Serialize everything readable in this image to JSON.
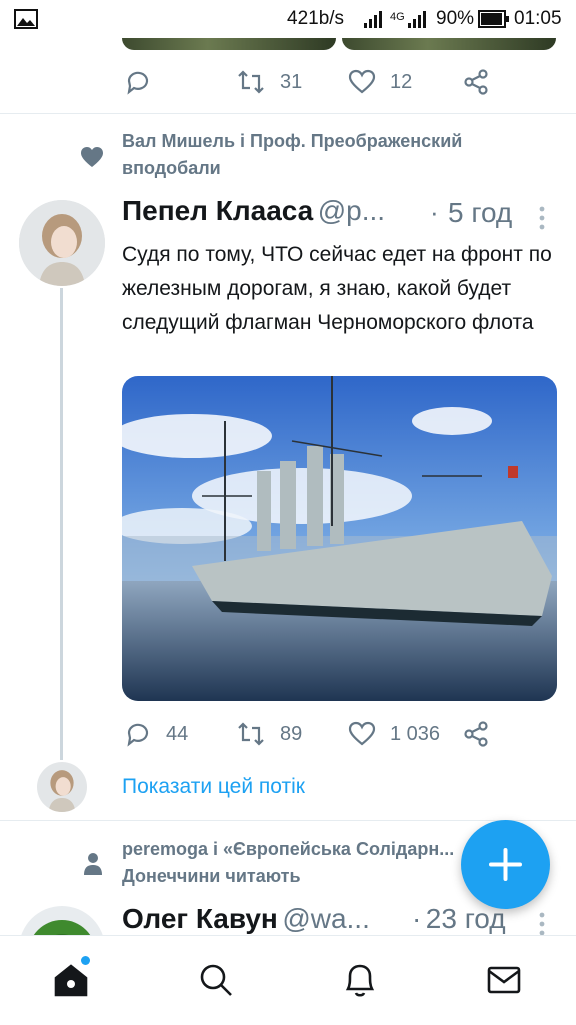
{
  "status_bar": {
    "speed": "421b/s",
    "network": "4G",
    "battery": "90%",
    "time": "01:05"
  },
  "prev_tweet": {
    "retweets": "31",
    "likes": "12"
  },
  "tweet": {
    "social_context": "Вал Мишель і Проф. Преображенский вподобали",
    "author_name": "Пепел Клааса",
    "author_handle": "@p...",
    "separator": "·",
    "time_ago": "5 год",
    "text": "Судя по тому, ЧТО сейчас едет на фронт по железным дорогам, я знаю, какой будет следущий флагман Черноморского флота",
    "replies": "44",
    "retweets": "89",
    "likes": "1 036",
    "show_thread": "Показати цей потік"
  },
  "next_tweet": {
    "social_context": "peremoga і «Європейська Солідарн... Донеччини читають",
    "author_name": "Олег Кавун",
    "author_handle": "@wa...",
    "separator": "·",
    "time_ago": "23 год"
  },
  "fab": {
    "icon": "compose-plus-icon",
    "label": "+"
  },
  "bottom_nav": [
    "home-icon",
    "search-icon",
    "notifications-icon",
    "messages-icon"
  ],
  "colors": {
    "accent": "#1da1f2",
    "secondary_text": "#657786",
    "notification_dot": "#1da1f2"
  }
}
